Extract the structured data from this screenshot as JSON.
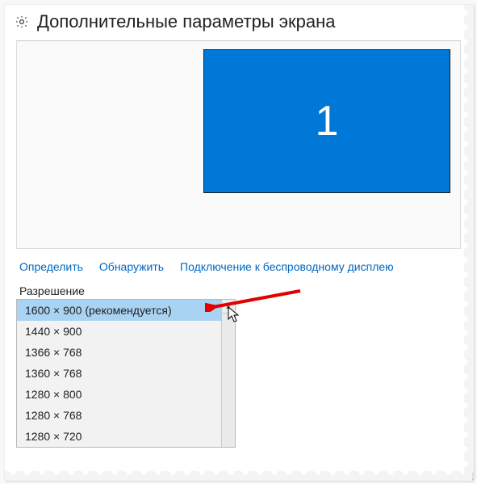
{
  "header": {
    "icon": "gear-icon",
    "title": "Дополнительные параметры экрана"
  },
  "display_preview": {
    "monitor_number": "1",
    "accent_color": "#0078D7"
  },
  "links": {
    "detect": "Определить",
    "discover": "Обнаружить",
    "wireless": "Подключение к беспроводному дисплею"
  },
  "resolution": {
    "label": "Разрешение",
    "selected_index": 0,
    "options": [
      "1600 × 900 (рекомендуется)",
      "1440 × 900",
      "1366 × 768",
      "1360 × 768",
      "1280 × 800",
      "1280 × 768",
      "1280 × 720"
    ]
  }
}
